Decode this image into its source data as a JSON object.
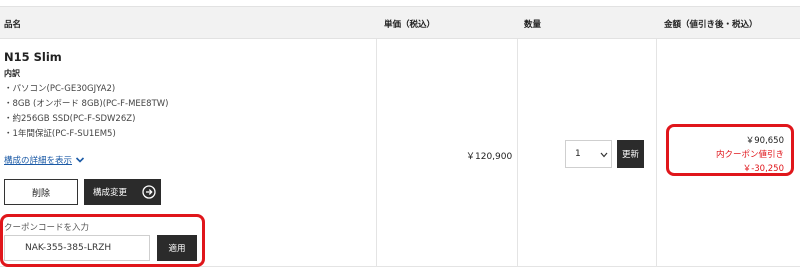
{
  "table_header": {
    "name": "品名",
    "unit_price": "単価（税込）",
    "quantity": "数量",
    "amount": "金額（値引き後・税込）"
  },
  "product": {
    "name": "N15 Slim",
    "detail_heading": "内訳",
    "specs": [
      "・パソコン(PC-GE30GJYA2)",
      "・8GB (オンボード 8GB)(PC-F-MEE8TW)",
      "・約256GB SSD(PC-F-SDW26Z)",
      "・1年間保証(PC-F-SU1EM5)"
    ],
    "detail_link": "構成の詳細を表示",
    "delete_label": "削除",
    "config_label": "構成変更"
  },
  "coupon": {
    "label": "クーポンコードを入力",
    "value": "NAK-355-385-LRZH",
    "apply_label": "適用"
  },
  "pricing": {
    "unit_price": "￥120,900",
    "quantity_selected": "1",
    "update_label": "更新",
    "amount": "￥90,650",
    "discount_label": "内クーポン値引き",
    "discount_value": "￥-30,250"
  },
  "colors": {
    "highlight": "#e0161b",
    "button_dark": "#2b2b2b",
    "link": "#1b5aa6",
    "header_bg": "#f2f2f2"
  },
  "icons": {
    "detail_toggle": "chevron-down-icon",
    "config_button": "arrow-right-circle-icon",
    "quantity_select": "caret-down-icon"
  }
}
